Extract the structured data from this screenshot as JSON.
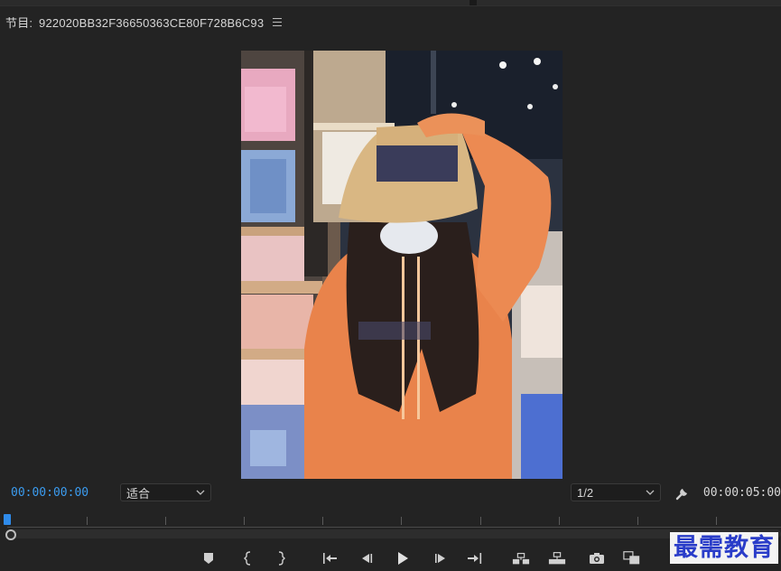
{
  "panel": {
    "title_prefix": "节目:",
    "sequence_name": "922020BB32F36650363CE80F728B6C93",
    "menu_icon": "hamburger-menu-icon"
  },
  "controls": {
    "current_timecode": "00:00:00:00",
    "fit_label": "适合",
    "resolution_label": "1/2",
    "duration_timecode": "00:00:05:00",
    "accent_color": "#3b9cf0"
  },
  "transport": {
    "icons": [
      "marker-icon",
      "mark-in-icon",
      "mark-out-icon",
      "go-to-in-icon",
      "step-back-icon",
      "play-icon",
      "step-forward-icon",
      "go-to-out-icon",
      "insert-icon",
      "overwrite-icon",
      "export-frame-icon",
      "compare-view-icon"
    ]
  },
  "watermark": {
    "text": "最需教育"
  }
}
